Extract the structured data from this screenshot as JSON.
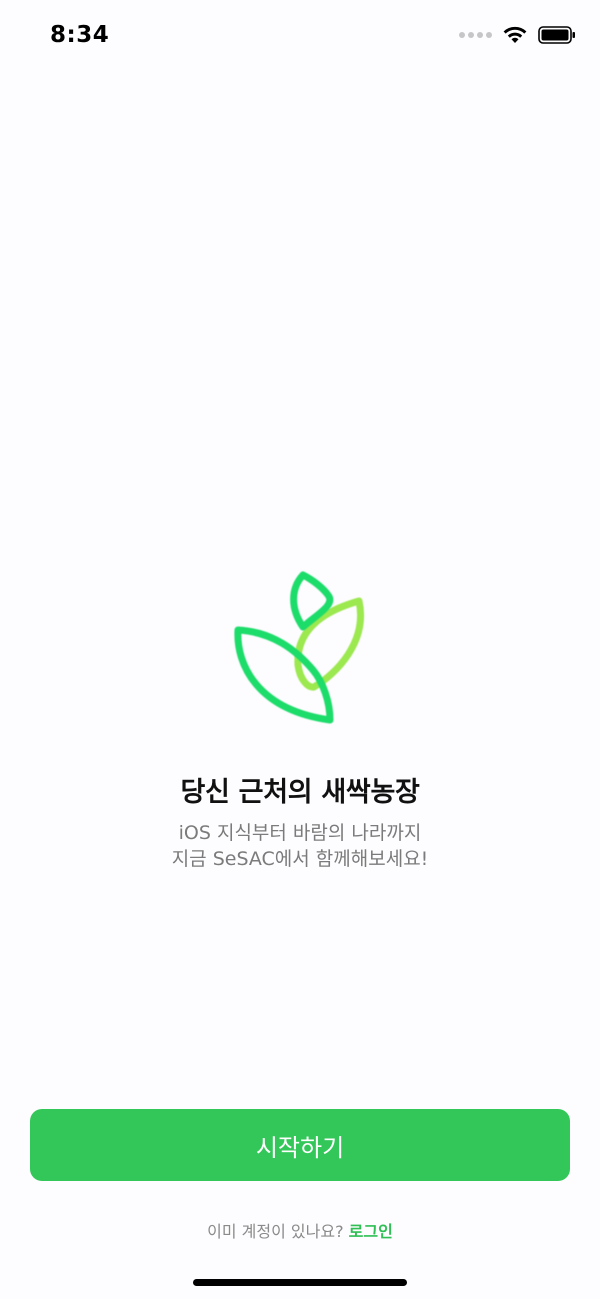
{
  "status_bar": {
    "time": "8:34",
    "signal_icon": "signal-dots-icon",
    "wifi_icon": "wifi-icon",
    "battery_icon": "battery-icon"
  },
  "logo": {
    "icon": "sprout-leaves-icon",
    "colors": {
      "leaf_dark": "#1fdc6a",
      "leaf_light": "#9be84f"
    }
  },
  "onboarding": {
    "headline": "당신 근처의 새싹농장",
    "sub_line_1": "iOS 지식부터 바람의 나라까지",
    "sub_line_2": "지금 SeSAC에서 함께해보세요!"
  },
  "actions": {
    "start_label": "시작하기",
    "login_prompt": "이미 계정이 있나요?",
    "login_link": "로그인"
  },
  "colors": {
    "accent": "#33c75a",
    "link": "#2fbf55",
    "subtext": "#7b7b7b"
  }
}
